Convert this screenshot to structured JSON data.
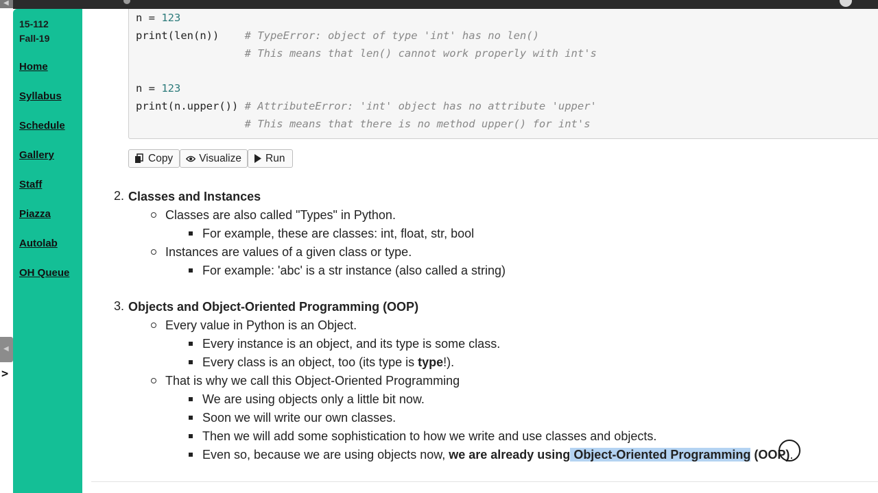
{
  "sidebar": {
    "course_number": "15-112",
    "semester": "Fall-19",
    "nav": [
      "Home",
      "Syllabus",
      "Schedule",
      "Gallery",
      "Staff",
      "Piazza",
      "Autolab",
      "OH Queue"
    ]
  },
  "edge": {
    "tab_glyph": "◀",
    "prompt": ">"
  },
  "code": {
    "lines": [
      {
        "pre": "n = ",
        "num": "123",
        "comment": ""
      },
      {
        "pre": "print(len(n))    ",
        "num": "",
        "comment": "# TypeError: object of type 'int' has no len()"
      },
      {
        "pre": "                 ",
        "num": "",
        "comment": "# This means that len() cannot work properly with int's"
      },
      {
        "pre": "n = ",
        "num": "123",
        "comment": ""
      },
      {
        "pre": "print(n.upper()) ",
        "num": "",
        "comment": "# AttributeError: 'int' object has no attribute 'upper'"
      },
      {
        "pre": "                 ",
        "num": "",
        "comment": "# This means that there is no method upper() for int's"
      }
    ]
  },
  "buttons": {
    "copy": "Copy",
    "visualize": "Visualize",
    "run": "Run"
  },
  "sections": {
    "s2": {
      "num": "2.",
      "title": "Classes and Instances",
      "b1": "Classes are also called \"Types\" in Python.",
      "b1_sub": "For example, these are classes: int, float, str, bool",
      "b2": "Instances are values of a given class or type.",
      "b2_sub": "For example: 'abc' is a str instance (also called a string)"
    },
    "s3": {
      "num": "3.",
      "title": "Objects and Object-Oriented Programming (OOP)",
      "b1": "Every value in Python is an Object.",
      "b1_sub1": "Every instance is an object, and its type is some class.",
      "b1_sub2_pre": "Every class is an object, too (its type is ",
      "b1_sub2_bold": "type",
      "b1_sub2_post": "!).",
      "b2": "That is why we call this Object-Oriented Programming",
      "b2_sub1": "We are using objects only a little bit now.",
      "b2_sub2": "Soon we will write our own classes.",
      "b2_sub3": "Then we will add some sophistication to how we write and use classes and objects.",
      "b2_sub4_pre": "Even so, because we are using objects now, ",
      "b2_sub4_bold1": "we are already using",
      "b2_sub4_hl": " Object-Oriented Programming",
      "b2_sub4_bold2": " (OOP)",
      "b2_sub4_post": "."
    }
  },
  "colors": {
    "sidebar": "#14bf96",
    "highlight": "#b4d3f2",
    "code_bg": "#f6f6f6",
    "number": "#2b7a7a",
    "comment": "#888888"
  }
}
